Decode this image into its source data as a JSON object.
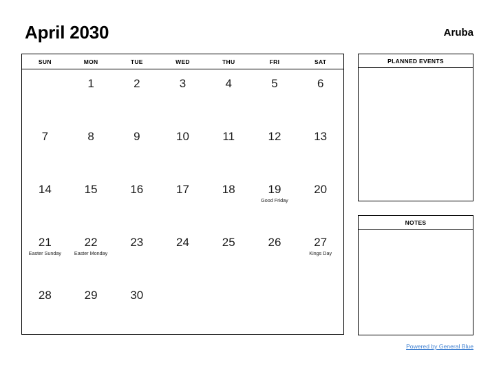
{
  "header": {
    "title": "April 2030",
    "location": "Aruba"
  },
  "calendar": {
    "weekday_headers": [
      "SUN",
      "MON",
      "TUE",
      "WED",
      "THU",
      "FRI",
      "SAT"
    ],
    "weeks": [
      [
        {
          "day": "",
          "event": ""
        },
        {
          "day": "1",
          "event": ""
        },
        {
          "day": "2",
          "event": ""
        },
        {
          "day": "3",
          "event": ""
        },
        {
          "day": "4",
          "event": ""
        },
        {
          "day": "5",
          "event": ""
        },
        {
          "day": "6",
          "event": ""
        }
      ],
      [
        {
          "day": "7",
          "event": ""
        },
        {
          "day": "8",
          "event": ""
        },
        {
          "day": "9",
          "event": ""
        },
        {
          "day": "10",
          "event": ""
        },
        {
          "day": "11",
          "event": ""
        },
        {
          "day": "12",
          "event": ""
        },
        {
          "day": "13",
          "event": ""
        }
      ],
      [
        {
          "day": "14",
          "event": ""
        },
        {
          "day": "15",
          "event": ""
        },
        {
          "day": "16",
          "event": ""
        },
        {
          "day": "17",
          "event": ""
        },
        {
          "day": "18",
          "event": ""
        },
        {
          "day": "19",
          "event": "Good Friday"
        },
        {
          "day": "20",
          "event": ""
        }
      ],
      [
        {
          "day": "21",
          "event": "Easter Sunday"
        },
        {
          "day": "22",
          "event": "Easter Monday"
        },
        {
          "day": "23",
          "event": ""
        },
        {
          "day": "24",
          "event": ""
        },
        {
          "day": "25",
          "event": ""
        },
        {
          "day": "26",
          "event": ""
        },
        {
          "day": "27",
          "event": "Kings Day"
        }
      ],
      [
        {
          "day": "28",
          "event": ""
        },
        {
          "day": "29",
          "event": ""
        },
        {
          "day": "30",
          "event": ""
        },
        {
          "day": "",
          "event": ""
        },
        {
          "day": "",
          "event": ""
        },
        {
          "day": "",
          "event": ""
        },
        {
          "day": "",
          "event": ""
        }
      ]
    ]
  },
  "panels": {
    "planned_events": {
      "title": "PLANNED EVENTS",
      "content": ""
    },
    "notes": {
      "title": "NOTES",
      "content": ""
    }
  },
  "footer": {
    "credit_text": "Powered by General Blue",
    "link_color": "#3d7fd1"
  }
}
